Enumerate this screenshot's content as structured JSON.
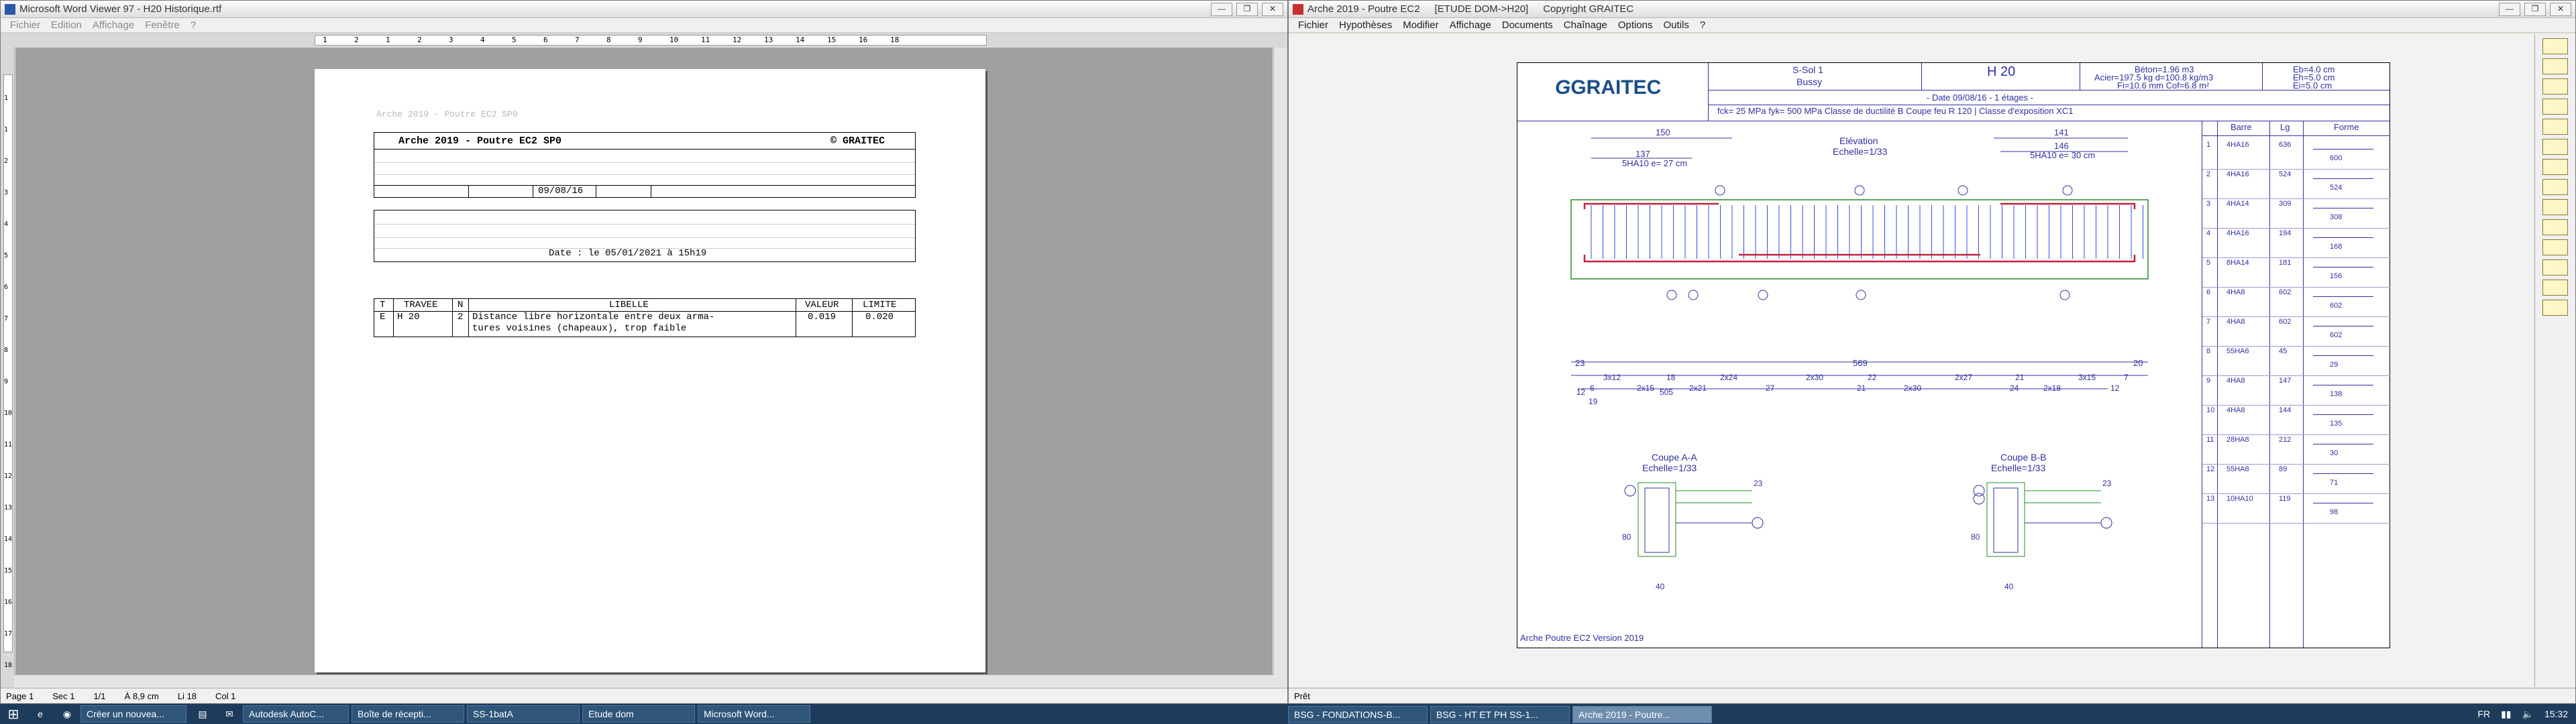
{
  "left_window": {
    "title": "Microsoft Word Viewer 97 - H20 Historique.rtf",
    "menu": [
      "Fichier",
      "Edition",
      "Affichage",
      "Fenêtre",
      "?"
    ],
    "ruler_marks": [
      "1",
      "2",
      "1",
      "2",
      "3",
      "4",
      "5",
      "6",
      "7",
      "8",
      "9",
      "10",
      "11",
      "12",
      "13",
      "14",
      "15",
      "16",
      "18"
    ],
    "vruler_marks": [
      "1",
      "1",
      "2",
      "3",
      "4",
      "5",
      "6",
      "7",
      "8",
      "9",
      "10",
      "11",
      "12",
      "13",
      "14",
      "15",
      "16",
      "17",
      "18"
    ],
    "doc": {
      "watermark": "Arche 2019 - Poutre EC2 SP0",
      "header_title": "Arche 2019 - Poutre EC2 SP0",
      "header_copy": "© GRAITEC",
      "header_date": "09/08/16",
      "date_line": "Date : le  05/01/2021 à 15h19",
      "table": {
        "headers": [
          "T",
          "TRAVEE",
          "N",
          "LIBELLE",
          "VALEUR",
          "LIMITE"
        ],
        "row": {
          "t": "E",
          "travee": "H 20",
          "n": "2",
          "libelle_1": "Distance libre horizontale entre deux arma-",
          "libelle_2": "tures voisines (chapeaux), trop faible",
          "valeur": "0.019",
          "limite": "0.020"
        }
      }
    },
    "status": {
      "page": "Page 1",
      "sec": "Sec 1",
      "pages": "1/1",
      "pos": "À 8,9 cm",
      "line": "Li 18",
      "col": "Col 1"
    }
  },
  "right_window": {
    "title": "Arche 2019 - Poutre EC2",
    "title_extra": "[ETUDE DOM->H20]",
    "title_copy": "Copyright GRAITEC",
    "menu": [
      "Fichier",
      "Hypothèses",
      "Modifier",
      "Affichage",
      "Documents",
      "Chaînage",
      "Options",
      "Outils",
      "?"
    ],
    "status": "Prêt",
    "drawing": {
      "logo": "GRAITEC",
      "project": "S-Sol 1",
      "location": "Bussy",
      "element": "H 20",
      "beton": "Béton=1.96 m3",
      "acier": "Acier=197.5 kg d=100.8 kg/m3",
      "fi": "Fi=10.6 mm Cof=6.8 m²",
      "eb": "Eb=4.0 cm",
      "eh": "Eh=5.0 cm",
      "ei": "Ei=5.0 cm",
      "date_line": "- Date 09/08/16 - 1 étages -",
      "materials": "fck=    25 MPa fyk=  500 MPa  Classe de ductilité B Coupe feu R 120     | Classe d'exposition  XC1",
      "elev_title": "Elévation",
      "elev_scale": "Echelle=1/33",
      "coupe_aa": "Coupe A-A",
      "coupe_bb": "Coupe B-B",
      "coupe_scale": "Echelle=1/33",
      "footer": "Arche Poutre EC2 Version 2019",
      "dim_labels": {
        "d150": "150",
        "d137": "137",
        "d5ha10_27": "5HA10 e= 27 cm",
        "d141": "141",
        "d146": "146",
        "d5ha10_30": "5HA10 e= 30 cm",
        "d23": "23",
        "d569": "569",
        "d20": "20",
        "c1": "3x12",
        "c2": "18",
        "c3": "2x24",
        "c4": "2x30",
        "c5": "22",
        "c6": "2x27",
        "c7": "21",
        "c8": "3x15",
        "c9": "7",
        "c10": "12",
        "c11": "6",
        "c12": "2x15",
        "c13": "505",
        "c14": "2x21",
        "c15": "27",
        "c16": "21",
        "c17": "2x30",
        "c18": "24",
        "c19": "2x18",
        "c20": "12",
        "c21": "19",
        "s40": "40",
        "s80": "80",
        "s23": "23"
      },
      "bar_table": {
        "headers": [
          "Barre",
          "Lg",
          "Forme"
        ],
        "rows": [
          {
            "n": "1",
            "barre": "4HA16",
            "lg": "636",
            "forme": "600"
          },
          {
            "n": "2",
            "barre": "4HA16",
            "lg": "524",
            "forme": "524"
          },
          {
            "n": "3",
            "barre": "4HA14",
            "lg": "309",
            "forme": "308"
          },
          {
            "n": "4",
            "barre": "4HA16",
            "lg": "194",
            "forme": "168"
          },
          {
            "n": "5",
            "barre": "8HA14",
            "lg": "181",
            "forme": "156"
          },
          {
            "n": "6",
            "barre": "4HA8",
            "lg": "602",
            "forme": "602"
          },
          {
            "n": "7",
            "barre": "4HA8",
            "lg": "602",
            "forme": "602"
          },
          {
            "n": "8",
            "barre": "55HA6",
            "lg": "45",
            "forme": "29"
          },
          {
            "n": "9",
            "barre": "4HA8",
            "lg": "147",
            "forme": "138"
          },
          {
            "n": "10",
            "barre": "4HA8",
            "lg": "144",
            "forme": "135"
          },
          {
            "n": "11",
            "barre": "28HA8",
            "lg": "212",
            "forme": "30"
          },
          {
            "n": "12",
            "barre": "55HA8",
            "lg": "89",
            "forme": "71"
          },
          {
            "n": "13",
            "barre": "10HA10",
            "lg": "119",
            "forme": "98"
          }
        ]
      }
    }
  },
  "taskbar": {
    "items": [
      "Créer un nouvea...",
      "Autodesk AutoC...",
      "Boîte de récepti...",
      "SS-1batA",
      "Etude dom",
      "Microsoft Word...",
      "BSG - FONDATIONS-B...",
      "BSG - HT ET PH SS-1...",
      "Arche 2019 - Poutre..."
    ],
    "lang": "FR",
    "time": "15:32"
  }
}
